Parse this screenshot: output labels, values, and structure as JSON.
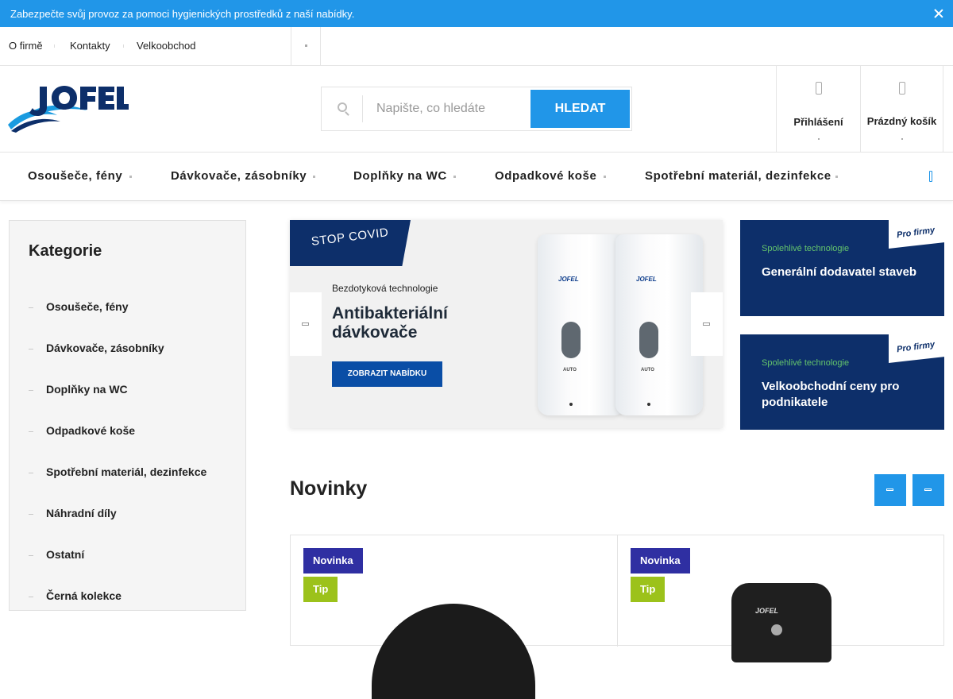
{
  "topbar": {
    "message": "Zabezpečte svůj provoz za pomoci hygienických prostředků z naší nabídky."
  },
  "links": [
    "O firmě",
    "Kontakty",
    "Velkoobchod"
  ],
  "search": {
    "placeholder": "Napište, co hledáte",
    "button": "HLEDAT"
  },
  "account": {
    "login": "Přihlášení",
    "cart": "Prázdný košík"
  },
  "nav": [
    "Osoušeče, fény",
    "Dávkovače, zásobníky",
    "Doplňky na WC",
    "Odpadkové koše",
    "Spotřební materiál, dezinfekce"
  ],
  "sidebar": {
    "title": "Kategorie",
    "items": [
      "Osoušeče, fény",
      "Dávkovače, zásobníky",
      "Doplňky na WC",
      "Odpadkové koše",
      "Spotřební materiál, dezinfekce",
      "Náhradní díly",
      "Ostatní",
      "Černá kolekce"
    ]
  },
  "carousel": {
    "ribbon": "STOP COVID",
    "subtitle": "Bezdotyková technologie",
    "headline": "Antibakteriální dávkovače",
    "cta": "ZOBRAZIT NABÍDKU",
    "product_logo": "JOFEL",
    "product_label": "AUTO"
  },
  "banners": [
    {
      "tag": "Pro firmy",
      "pre": "Spolehlivé technologie",
      "title": "Generální dodavatel staveb"
    },
    {
      "tag": "Pro firmy",
      "pre": "Spolehlivé technologie",
      "title": "Velkoobchodní ceny pro podnikatele"
    }
  ],
  "novinky": {
    "title": "Novinky",
    "products": [
      {
        "badge_new": "Novinka",
        "badge_tip": "Tip"
      },
      {
        "badge_new": "Novinka",
        "badge_tip": "Tip",
        "logo": "JOFEL"
      }
    ]
  },
  "colors": {
    "accent": "#2196e8",
    "brand_navy": "#0d2f6a",
    "badge_new": "#2f2fa2",
    "badge_tip": "#9cc21b"
  }
}
